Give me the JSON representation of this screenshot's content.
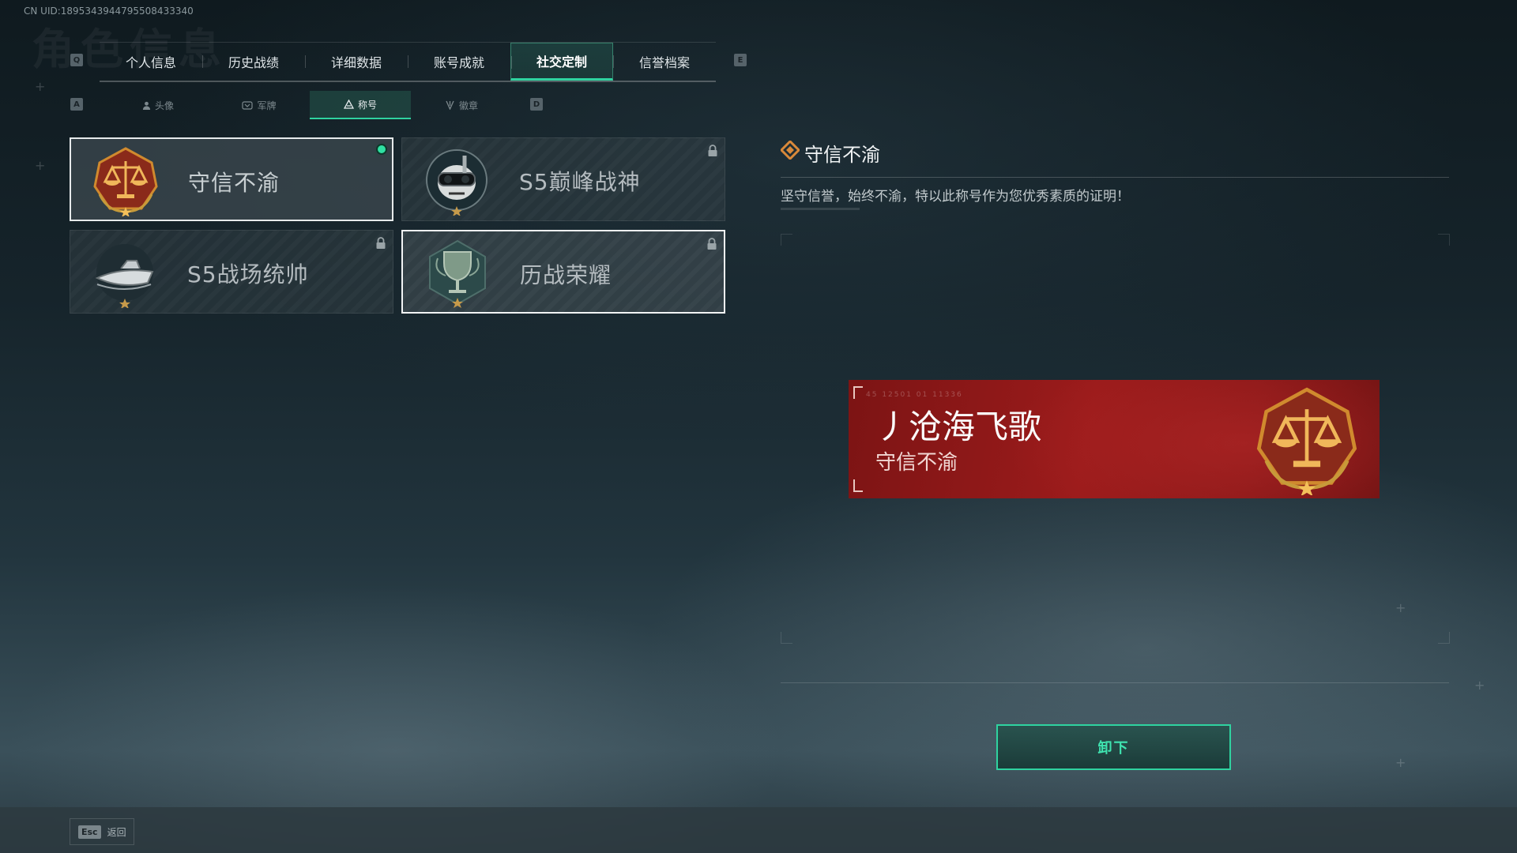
{
  "uid": "CN UID:1895343944795508433340",
  "bg_title": "角色信息",
  "keys": {
    "prev_tab": "Q",
    "next_tab": "E",
    "prev_sub": "A",
    "next_sub": "D"
  },
  "tabs": [
    {
      "label": "个人信息",
      "active": false
    },
    {
      "label": "历史战绩",
      "active": false
    },
    {
      "label": "详细数据",
      "active": false
    },
    {
      "label": "账号成就",
      "active": false
    },
    {
      "label": "社交定制",
      "active": true
    },
    {
      "label": "信誉档案",
      "active": false
    }
  ],
  "subtabs": [
    {
      "label": "头像",
      "icon": "person-icon"
    },
    {
      "label": "军牌",
      "icon": "dogtag-icon"
    },
    {
      "label": "称号",
      "icon": "title-icon",
      "active": true
    },
    {
      "label": "徽章",
      "icon": "emblem-icon"
    }
  ],
  "titles": [
    {
      "name": "守信不渝",
      "badge": "scales-badge",
      "equipped": true,
      "locked": false
    },
    {
      "name": "S5巅峰战神",
      "badge": "diver-skull-badge",
      "locked": true
    },
    {
      "name": "S5战场统帅",
      "badge": "speedboat-badge",
      "locked": true
    },
    {
      "name": "历战荣耀",
      "badge": "trophy-badge",
      "locked": true,
      "selected": true
    }
  ],
  "detail": {
    "title": "守信不渝",
    "description": "坚守信誉，始终不渝，特以此称号作为您优秀素质的证明！"
  },
  "preview": {
    "player_name": "丿沧海飞歌",
    "title_text": "守信不渝",
    "small_code": "45 12501   01 11336"
  },
  "action_button": "卸下",
  "footer": {
    "esc_key": "Esc",
    "esc_label": "返回"
  },
  "colors": {
    "accent": "#2fd3a0",
    "preview_red": "#9b1b1b",
    "badge_gold": "#d08a2e"
  }
}
